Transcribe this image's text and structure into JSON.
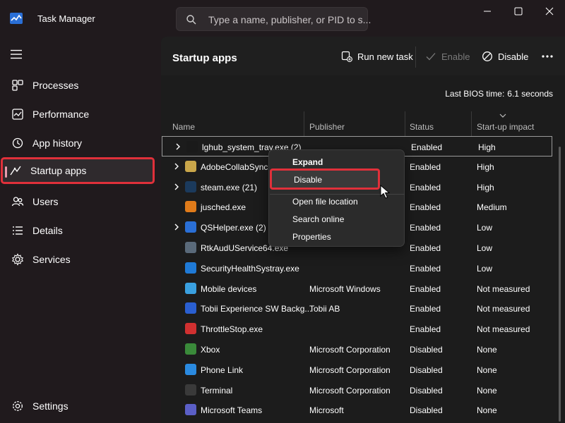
{
  "window": {
    "title": "Task Manager",
    "search_placeholder": "Type a name, publisher, or PID to s..."
  },
  "sidebar": {
    "items": [
      {
        "label": "Processes",
        "icon": "processes-icon"
      },
      {
        "label": "Performance",
        "icon": "performance-icon"
      },
      {
        "label": "App history",
        "icon": "app-history-icon"
      },
      {
        "label": "Startup apps",
        "icon": "startup-apps-icon",
        "active": true
      },
      {
        "label": "Users",
        "icon": "users-icon"
      },
      {
        "label": "Details",
        "icon": "details-icon"
      },
      {
        "label": "Services",
        "icon": "services-icon"
      }
    ],
    "settings_label": "Settings"
  },
  "toolbar": {
    "page_title": "Startup apps",
    "run_new_task": "Run new task",
    "enable": "Enable",
    "disable": "Disable"
  },
  "bios": {
    "label": "Last BIOS time:",
    "value": "6.1 seconds"
  },
  "table": {
    "columns": [
      "Name",
      "Publisher",
      "Status",
      "Start-up impact"
    ],
    "rows": [
      {
        "name": "lghub_system_tray.exe (2)",
        "publisher": "",
        "status": "Enabled",
        "impact": "High",
        "expandable": true,
        "icon_color": "#1a1a1a",
        "selected": true
      },
      {
        "name": "AdobeCollabSync.exe",
        "publisher": "",
        "status": "Enabled",
        "impact": "High",
        "expandable": true,
        "icon_color": "#c9a64a"
      },
      {
        "name": "steam.exe (21)",
        "publisher": "",
        "status": "Enabled",
        "impact": "High",
        "expandable": true,
        "icon_color": "#1b3a5c"
      },
      {
        "name": "jusched.exe",
        "publisher": "",
        "status": "Enabled",
        "impact": "Medium",
        "expandable": false,
        "icon_color": "#e07b1a"
      },
      {
        "name": "QSHelper.exe (2)",
        "publisher": "",
        "status": "Enabled",
        "impact": "Low",
        "expandable": true,
        "icon_color": "#2a6fd6"
      },
      {
        "name": "RtkAudUService64.exe",
        "publisher": "",
        "status": "Enabled",
        "impact": "Low",
        "expandable": false,
        "icon_color": "#5a6a7a"
      },
      {
        "name": "SecurityHealthSystray.exe",
        "publisher": "",
        "status": "Enabled",
        "impact": "Low",
        "expandable": false,
        "icon_color": "#1f7ad6"
      },
      {
        "name": "Mobile devices",
        "publisher": "Microsoft Windows",
        "status": "Enabled",
        "impact": "Not measured",
        "expandable": false,
        "icon_color": "#3aa0e0"
      },
      {
        "name": "Tobii Experience SW Backg...",
        "publisher": "Tobii AB",
        "status": "Enabled",
        "impact": "Not measured",
        "expandable": false,
        "icon_color": "#2a5fd0"
      },
      {
        "name": "ThrottleStop.exe",
        "publisher": "",
        "status": "Enabled",
        "impact": "Not measured",
        "expandable": false,
        "icon_color": "#d03030"
      },
      {
        "name": "Xbox",
        "publisher": "Microsoft Corporation",
        "status": "Disabled",
        "impact": "None",
        "expandable": false,
        "icon_color": "#3a8a3a"
      },
      {
        "name": "Phone Link",
        "publisher": "Microsoft Corporation",
        "status": "Disabled",
        "impact": "None",
        "expandable": false,
        "icon_color": "#2a8ae0"
      },
      {
        "name": "Terminal",
        "publisher": "Microsoft Corporation",
        "status": "Disabled",
        "impact": "None",
        "expandable": false,
        "icon_color": "#3a3a3a"
      },
      {
        "name": "Microsoft Teams",
        "publisher": "Microsoft",
        "status": "Disabled",
        "impact": "None",
        "expandable": false,
        "icon_color": "#5b5fc7"
      }
    ]
  },
  "context_menu": {
    "items": [
      {
        "label": "Expand",
        "bold": true
      },
      {
        "label": "Disable",
        "hovered": true
      },
      {
        "label": "Open file location"
      },
      {
        "label": "Search online"
      },
      {
        "label": "Properties"
      }
    ]
  },
  "colors": {
    "highlight_box": "#e0303a",
    "active_indicator": "#e89cae",
    "window_bg": "#201a1d",
    "content_bg": "#1c1c1c"
  }
}
